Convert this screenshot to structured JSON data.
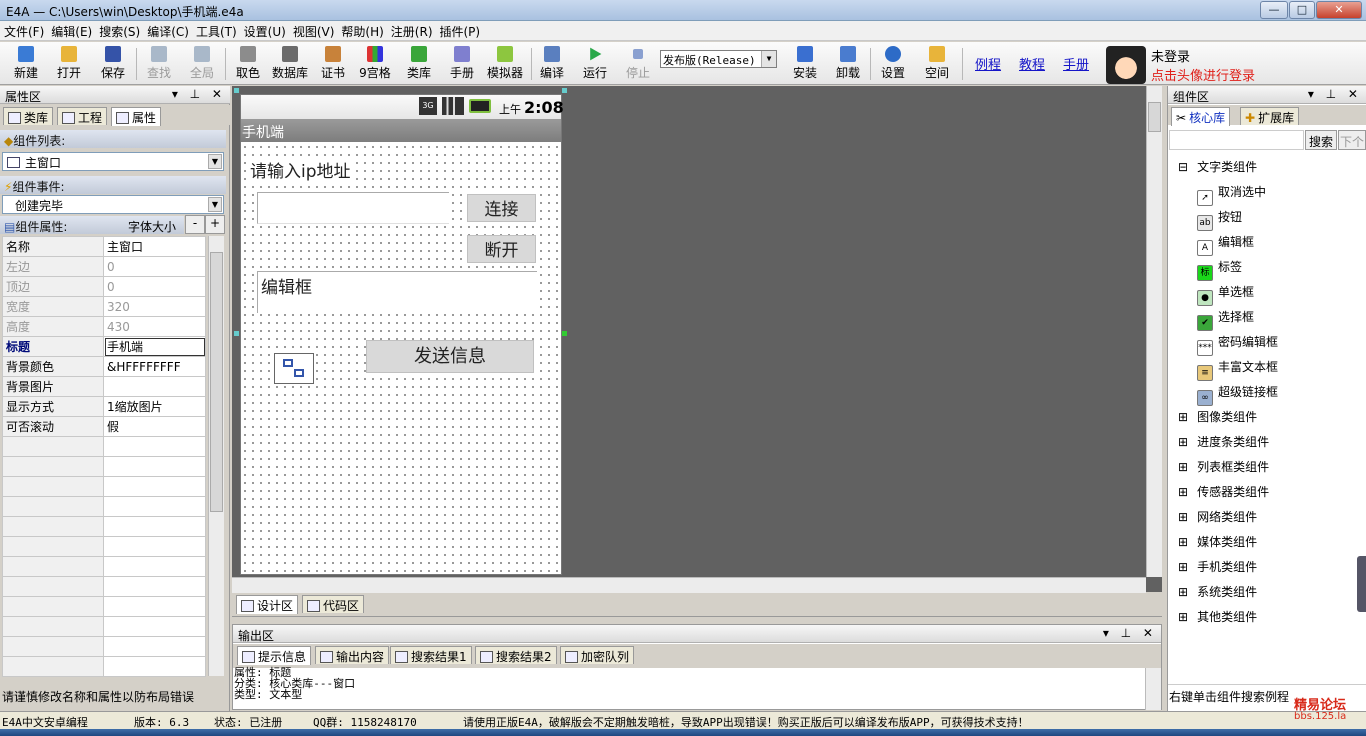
{
  "window": {
    "title": "E4A — C:\\Users\\win\\Desktop\\手机端.e4a",
    "min": "—",
    "max": "□",
    "close": "✕"
  },
  "menu": [
    "文件(F)",
    "编辑(E)",
    "搜索(S)",
    "编译(C)",
    "工具(T)",
    "设置(U)",
    "视图(V)",
    "帮助(H)",
    "注册(R)",
    "插件(P)"
  ],
  "toolbar": {
    "new": "新建",
    "open": "打开",
    "save": "保存",
    "find": "查找",
    "all": "全局",
    "color": "取色",
    "db": "数据库",
    "cert": "证书",
    "grid9": "9宫格",
    "lib": "类库",
    "manual": "手册",
    "emulator": "模拟器",
    "compile": "编译",
    "run": "运行",
    "stop": "停止",
    "build_mode": "发布版(Release)",
    "install": "安装",
    "uninstall": "卸载",
    "settings": "设置",
    "space": "空间",
    "link_example": "例程",
    "link_tutorial": "教程",
    "link_manual": "手册",
    "user_status": "未登录",
    "login_hint": "点击头像进行登录"
  },
  "left_panel": {
    "title": "属性区",
    "tabs": [
      "类库",
      "工程",
      "属性"
    ],
    "component_list_label": "组件列表:",
    "component_selected": "主窗口",
    "event_label": "组件事件:",
    "event_selected": "创建完毕",
    "props_label": "组件属性:",
    "font_size_label": "字体大小",
    "minus": "-",
    "plus": "+",
    "props": [
      {
        "k": "名称",
        "v": "主窗口"
      },
      {
        "k": "左边",
        "v": "0"
      },
      {
        "k": "顶边",
        "v": "0"
      },
      {
        "k": "宽度",
        "v": "320"
      },
      {
        "k": "高度",
        "v": "430"
      },
      {
        "k": "标题",
        "v": "手机端"
      },
      {
        "k": "背景颜色",
        "v": "&HFFFFFFFF"
      },
      {
        "k": "背景图片",
        "v": ""
      },
      {
        "k": "显示方式",
        "v": "1缩放图片"
      },
      {
        "k": "可否滚动",
        "v": "假"
      }
    ],
    "hint": "请谨慎修改名称和属性以防布局错误"
  },
  "phone": {
    "signal": "3G",
    "time_prefix": "上午",
    "time": "2:08",
    "app_title": "手机端",
    "label_ip": "请输入ip地址",
    "btn_connect": "连接",
    "btn_disconnect": "断开",
    "editbox": "编辑框",
    "btn_send": "发送信息"
  },
  "center_tabs": {
    "design": "设计区",
    "code": "代码区"
  },
  "output": {
    "title": "输出区",
    "tabs": [
      "提示信息",
      "输出内容",
      "搜索结果1",
      "搜索结果2",
      "加密队列"
    ],
    "lines": [
      "属性: 标题",
      "分类: 核心类库---窗口",
      "类型: 文本型"
    ]
  },
  "right_panel": {
    "title": "组件区",
    "tabs": [
      "核心库",
      "扩展库"
    ],
    "search_btn": "搜索",
    "next_btn": "下个",
    "tree": [
      {
        "label": "文字类组件",
        "exp": "⊟",
        "child": false
      },
      {
        "label": "取消选中",
        "child": true,
        "icon": "pointer"
      },
      {
        "label": "按钮",
        "child": true,
        "icon": "button"
      },
      {
        "label": "编辑框",
        "child": true,
        "icon": "edit"
      },
      {
        "label": "标签",
        "child": true,
        "icon": "label"
      },
      {
        "label": "单选框",
        "child": true,
        "icon": "radio"
      },
      {
        "label": "选择框",
        "child": true,
        "icon": "check"
      },
      {
        "label": "密码编辑框",
        "child": true,
        "icon": "password"
      },
      {
        "label": "丰富文本框",
        "child": true,
        "icon": "richtext"
      },
      {
        "label": "超级链接框",
        "child": true,
        "icon": "link"
      },
      {
        "label": "图像类组件",
        "exp": "⊞",
        "child": false
      },
      {
        "label": "进度条类组件",
        "exp": "⊞",
        "child": false
      },
      {
        "label": "列表框类组件",
        "exp": "⊞",
        "child": false
      },
      {
        "label": "传感器类组件",
        "exp": "⊞",
        "child": false
      },
      {
        "label": "网络类组件",
        "exp": "⊞",
        "child": false
      },
      {
        "label": "媒体类组件",
        "exp": "⊞",
        "child": false
      },
      {
        "label": "手机类组件",
        "exp": "⊞",
        "child": false
      },
      {
        "label": "系统类组件",
        "exp": "⊞",
        "child": false
      },
      {
        "label": "其他类组件",
        "exp": "⊞",
        "child": false
      }
    ],
    "hint": "右键单击组件搜索例程"
  },
  "status": {
    "app": "E4A中文安卓编程",
    "version": "版本: 6.3",
    "state": "状态: 已注册",
    "qq": "QQ群: 1158248170",
    "notice": "请使用正版E4A，破解版会不定期触发暗桩，导致APP出现错误！购买正版后可以编译发布版APP，可获得技术支持！"
  },
  "watermark": {
    "line1": "精易论坛",
    "line2": "bbs.125.la"
  }
}
